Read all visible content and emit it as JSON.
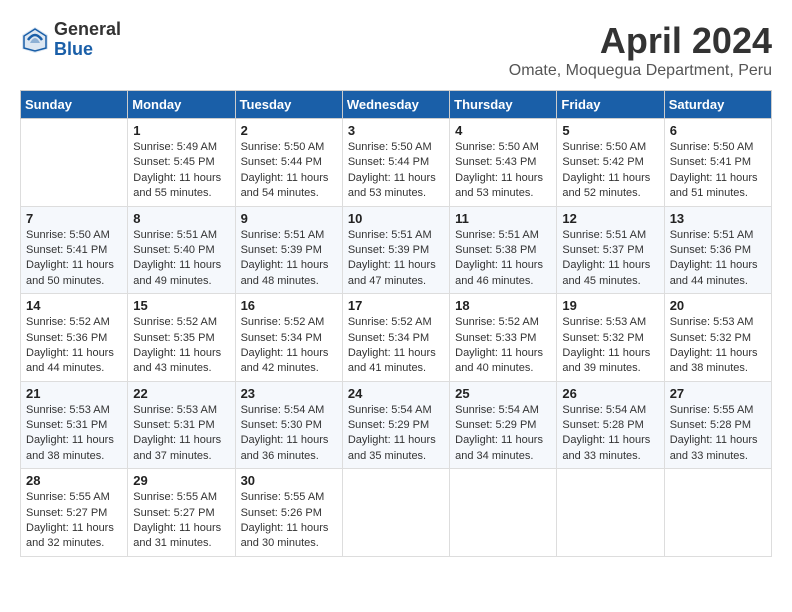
{
  "header": {
    "logo_general": "General",
    "logo_blue": "Blue",
    "month": "April 2024",
    "location": "Omate, Moquegua Department, Peru"
  },
  "days_of_week": [
    "Sunday",
    "Monday",
    "Tuesday",
    "Wednesday",
    "Thursday",
    "Friday",
    "Saturday"
  ],
  "weeks": [
    [
      {
        "day": "",
        "info": ""
      },
      {
        "day": "1",
        "info": "Sunrise: 5:49 AM\nSunset: 5:45 PM\nDaylight: 11 hours\nand 55 minutes."
      },
      {
        "day": "2",
        "info": "Sunrise: 5:50 AM\nSunset: 5:44 PM\nDaylight: 11 hours\nand 54 minutes."
      },
      {
        "day": "3",
        "info": "Sunrise: 5:50 AM\nSunset: 5:44 PM\nDaylight: 11 hours\nand 53 minutes."
      },
      {
        "day": "4",
        "info": "Sunrise: 5:50 AM\nSunset: 5:43 PM\nDaylight: 11 hours\nand 53 minutes."
      },
      {
        "day": "5",
        "info": "Sunrise: 5:50 AM\nSunset: 5:42 PM\nDaylight: 11 hours\nand 52 minutes."
      },
      {
        "day": "6",
        "info": "Sunrise: 5:50 AM\nSunset: 5:41 PM\nDaylight: 11 hours\nand 51 minutes."
      }
    ],
    [
      {
        "day": "7",
        "info": "Sunrise: 5:50 AM\nSunset: 5:41 PM\nDaylight: 11 hours\nand 50 minutes."
      },
      {
        "day": "8",
        "info": "Sunrise: 5:51 AM\nSunset: 5:40 PM\nDaylight: 11 hours\nand 49 minutes."
      },
      {
        "day": "9",
        "info": "Sunrise: 5:51 AM\nSunset: 5:39 PM\nDaylight: 11 hours\nand 48 minutes."
      },
      {
        "day": "10",
        "info": "Sunrise: 5:51 AM\nSunset: 5:39 PM\nDaylight: 11 hours\nand 47 minutes."
      },
      {
        "day": "11",
        "info": "Sunrise: 5:51 AM\nSunset: 5:38 PM\nDaylight: 11 hours\nand 46 minutes."
      },
      {
        "day": "12",
        "info": "Sunrise: 5:51 AM\nSunset: 5:37 PM\nDaylight: 11 hours\nand 45 minutes."
      },
      {
        "day": "13",
        "info": "Sunrise: 5:51 AM\nSunset: 5:36 PM\nDaylight: 11 hours\nand 44 minutes."
      }
    ],
    [
      {
        "day": "14",
        "info": "Sunrise: 5:52 AM\nSunset: 5:36 PM\nDaylight: 11 hours\nand 44 minutes."
      },
      {
        "day": "15",
        "info": "Sunrise: 5:52 AM\nSunset: 5:35 PM\nDaylight: 11 hours\nand 43 minutes."
      },
      {
        "day": "16",
        "info": "Sunrise: 5:52 AM\nSunset: 5:34 PM\nDaylight: 11 hours\nand 42 minutes."
      },
      {
        "day": "17",
        "info": "Sunrise: 5:52 AM\nSunset: 5:34 PM\nDaylight: 11 hours\nand 41 minutes."
      },
      {
        "day": "18",
        "info": "Sunrise: 5:52 AM\nSunset: 5:33 PM\nDaylight: 11 hours\nand 40 minutes."
      },
      {
        "day": "19",
        "info": "Sunrise: 5:53 AM\nSunset: 5:32 PM\nDaylight: 11 hours\nand 39 minutes."
      },
      {
        "day": "20",
        "info": "Sunrise: 5:53 AM\nSunset: 5:32 PM\nDaylight: 11 hours\nand 38 minutes."
      }
    ],
    [
      {
        "day": "21",
        "info": "Sunrise: 5:53 AM\nSunset: 5:31 PM\nDaylight: 11 hours\nand 38 minutes."
      },
      {
        "day": "22",
        "info": "Sunrise: 5:53 AM\nSunset: 5:31 PM\nDaylight: 11 hours\nand 37 minutes."
      },
      {
        "day": "23",
        "info": "Sunrise: 5:54 AM\nSunset: 5:30 PM\nDaylight: 11 hours\nand 36 minutes."
      },
      {
        "day": "24",
        "info": "Sunrise: 5:54 AM\nSunset: 5:29 PM\nDaylight: 11 hours\nand 35 minutes."
      },
      {
        "day": "25",
        "info": "Sunrise: 5:54 AM\nSunset: 5:29 PM\nDaylight: 11 hours\nand 34 minutes."
      },
      {
        "day": "26",
        "info": "Sunrise: 5:54 AM\nSunset: 5:28 PM\nDaylight: 11 hours\nand 33 minutes."
      },
      {
        "day": "27",
        "info": "Sunrise: 5:55 AM\nSunset: 5:28 PM\nDaylight: 11 hours\nand 33 minutes."
      }
    ],
    [
      {
        "day": "28",
        "info": "Sunrise: 5:55 AM\nSunset: 5:27 PM\nDaylight: 11 hours\nand 32 minutes."
      },
      {
        "day": "29",
        "info": "Sunrise: 5:55 AM\nSunset: 5:27 PM\nDaylight: 11 hours\nand 31 minutes."
      },
      {
        "day": "30",
        "info": "Sunrise: 5:55 AM\nSunset: 5:26 PM\nDaylight: 11 hours\nand 30 minutes."
      },
      {
        "day": "",
        "info": ""
      },
      {
        "day": "",
        "info": ""
      },
      {
        "day": "",
        "info": ""
      },
      {
        "day": "",
        "info": ""
      }
    ]
  ]
}
